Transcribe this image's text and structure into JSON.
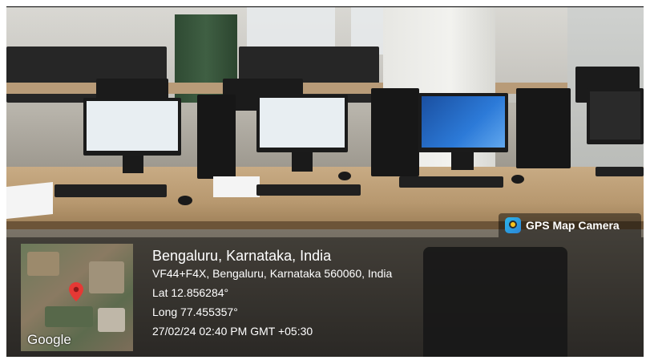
{
  "badge": {
    "label": "GPS Map Camera",
    "icon": "gps-map-camera-icon"
  },
  "map": {
    "brand": "Google",
    "pin_icon": "map-pin-icon",
    "pin_color": "#e53935"
  },
  "location": {
    "title": "Bengaluru, Karnataka, India",
    "address": "VF44+F4X, Bengaluru, Karnataka 560060, India",
    "lat": "Lat 12.856284°",
    "long": "Long 77.455357°",
    "datetime": "27/02/24 02:40 PM GMT +05:30"
  }
}
